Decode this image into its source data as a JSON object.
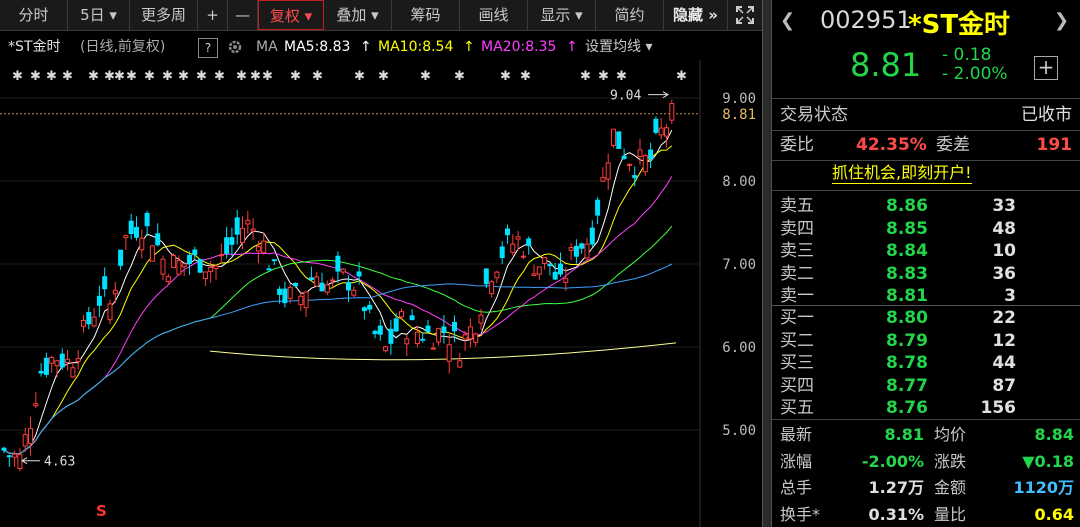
{
  "toolbar": {
    "items": [
      "分时",
      "5日 ▾",
      "更多周",
      "+",
      "—",
      "复权 ▾",
      "叠加 ▾",
      "筹码",
      "画线",
      "显示 ▾",
      "简约",
      "隐藏 »"
    ]
  },
  "info": {
    "title": "*ST金时",
    "sub": "(日线,前复权)",
    "help": "?",
    "ma": "MA",
    "ma5": "MA5:8.83",
    "ma10": "MA10:8.54",
    "ma20": "MA20:8.35",
    "settings": "设置均线 ▾",
    "colors": {
      "ma5": "#ffffff",
      "ma10": "#ffff00",
      "ma20": "#ff40ff"
    }
  },
  "chart_data": {
    "type": "candlestick",
    "y_ticks": [
      "9.00",
      "8.00",
      "7.00",
      "6.00",
      "5.00"
    ],
    "current_price_label": "8.81",
    "high_annotation": "9.04",
    "low_annotation": "4.63",
    "marker": "S",
    "colors": {
      "up": "#ff3c3c",
      "down": "#00e0ff",
      "ma5": "#ffffff",
      "ma10": "#ffff00",
      "ma20": "#ff40ff",
      "ma60": "#40ff40",
      "ma120": "#40a0ff",
      "ma250": "#ffff99"
    },
    "ylim": [
      4.3,
      9.2
    ]
  },
  "quote": {
    "code": "002951",
    "name": "*ST金时",
    "price": "8.81",
    "change": "- 0.18",
    "change_pct": "- 2.00%",
    "status_label": "交易状态",
    "status_value": "已收市",
    "weibi_label": "委比",
    "weibi_value": "42.35%",
    "weicha_label": "委差",
    "weicha_value": "191",
    "promo": "抓住机会,即刻开户!",
    "sells": [
      {
        "label": "卖五",
        "price": "8.86",
        "vol": "33"
      },
      {
        "label": "卖四",
        "price": "8.85",
        "vol": "48"
      },
      {
        "label": "卖三",
        "price": "8.84",
        "vol": "10"
      },
      {
        "label": "卖二",
        "price": "8.83",
        "vol": "36"
      },
      {
        "label": "卖一",
        "price": "8.81",
        "vol": "3"
      }
    ],
    "buys": [
      {
        "label": "买一",
        "price": "8.80",
        "vol": "22"
      },
      {
        "label": "买二",
        "price": "8.79",
        "vol": "12"
      },
      {
        "label": "买三",
        "price": "8.78",
        "vol": "44"
      },
      {
        "label": "买四",
        "price": "8.77",
        "vol": "87"
      },
      {
        "label": "买五",
        "price": "8.76",
        "vol": "156"
      }
    ],
    "stats": [
      {
        "k1": "最新",
        "v1": "8.81",
        "c1": "#21d64a",
        "k2": "均价",
        "v2": "8.84",
        "c2": "#21d64a"
      },
      {
        "k1": "涨幅",
        "v1": "-2.00%",
        "c1": "#21d64a",
        "k2": "涨跌",
        "v2": "▼0.18",
        "c2": "#21d64a"
      },
      {
        "k1": "总手",
        "v1": "1.27万",
        "c1": "#e0e0e0",
        "k2": "金额",
        "v2": "1120万",
        "c2": "#40c0ff"
      },
      {
        "k1": "换手*",
        "v1": "0.31%",
        "c1": "#e0e0e0",
        "k2": "量比",
        "v2": "0.64",
        "c2": "#ffff00"
      }
    ]
  }
}
